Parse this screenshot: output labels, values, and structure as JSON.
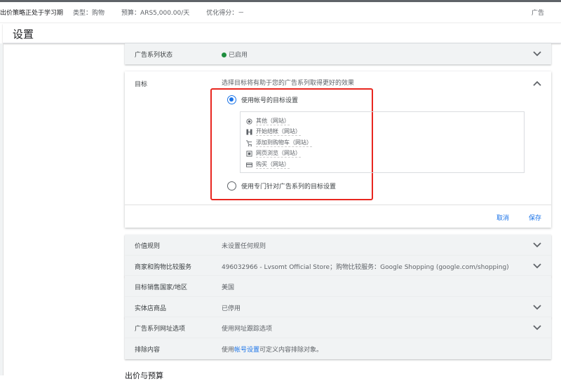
{
  "infobar": {
    "status": "出价策略正处于学习期",
    "type": "类型：购物",
    "budget": "预算：ARS5,000.00/天",
    "score": "优化得分：－",
    "right": "广告"
  },
  "header": {
    "title": "设置"
  },
  "rows_top": [
    {
      "label": "广告系列状态",
      "value": "已启用"
    }
  ],
  "goal_card": {
    "label": "目标",
    "description": "选择目标将有助于您的广告系列取得更好的效果",
    "option1": "使用帐号的目标设置",
    "option2": "使用专门针对广告系列的目标设置",
    "goals": [
      "其他（网站）",
      "开始结帐（网站）",
      "添加到购物车（网站）",
      "网页浏览（网站）",
      "购买（网站）"
    ],
    "cancel": "取消",
    "save": "保存"
  },
  "rows": [
    {
      "label": "价值规则",
      "value": "未设置任何规则"
    },
    {
      "label": "商家和购物比较服务",
      "value": "496032966 - Lvsomt Official Store；购物比较服务：Google Shopping (google.com/shopping)"
    },
    {
      "label": "目标销售国家/地区",
      "value": "美国"
    },
    {
      "label": "实体店商品",
      "value": "已停用"
    },
    {
      "label": "广告系列网址选项",
      "value": "使用网址跟踪选项"
    },
    {
      "label": "排除内容",
      "value_pre": "使用",
      "value_link": "帐号设置",
      "value_post": "可定义内容排除对象。"
    }
  ],
  "next_section": "出价与预算",
  "colors": {
    "accent": "#1a73e8",
    "highlight": "#e8261f",
    "enabled": "#1e8e3e"
  }
}
